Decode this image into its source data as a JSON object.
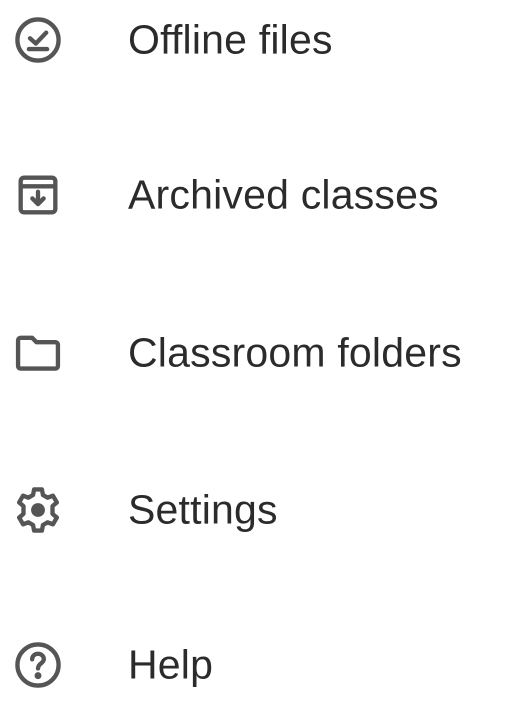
{
  "colors": {
    "background": "#ffffff",
    "text": "#2b2b2b",
    "icon": "#555555"
  },
  "menu": {
    "items": [
      {
        "label": "Offline files",
        "icon": "offline-check-icon"
      },
      {
        "label": "Archived classes",
        "icon": "archive-icon"
      },
      {
        "label": "Classroom folders",
        "icon": "folder-icon"
      },
      {
        "label": "Settings",
        "icon": "gear-icon"
      },
      {
        "label": "Help",
        "icon": "help-icon"
      }
    ]
  }
}
